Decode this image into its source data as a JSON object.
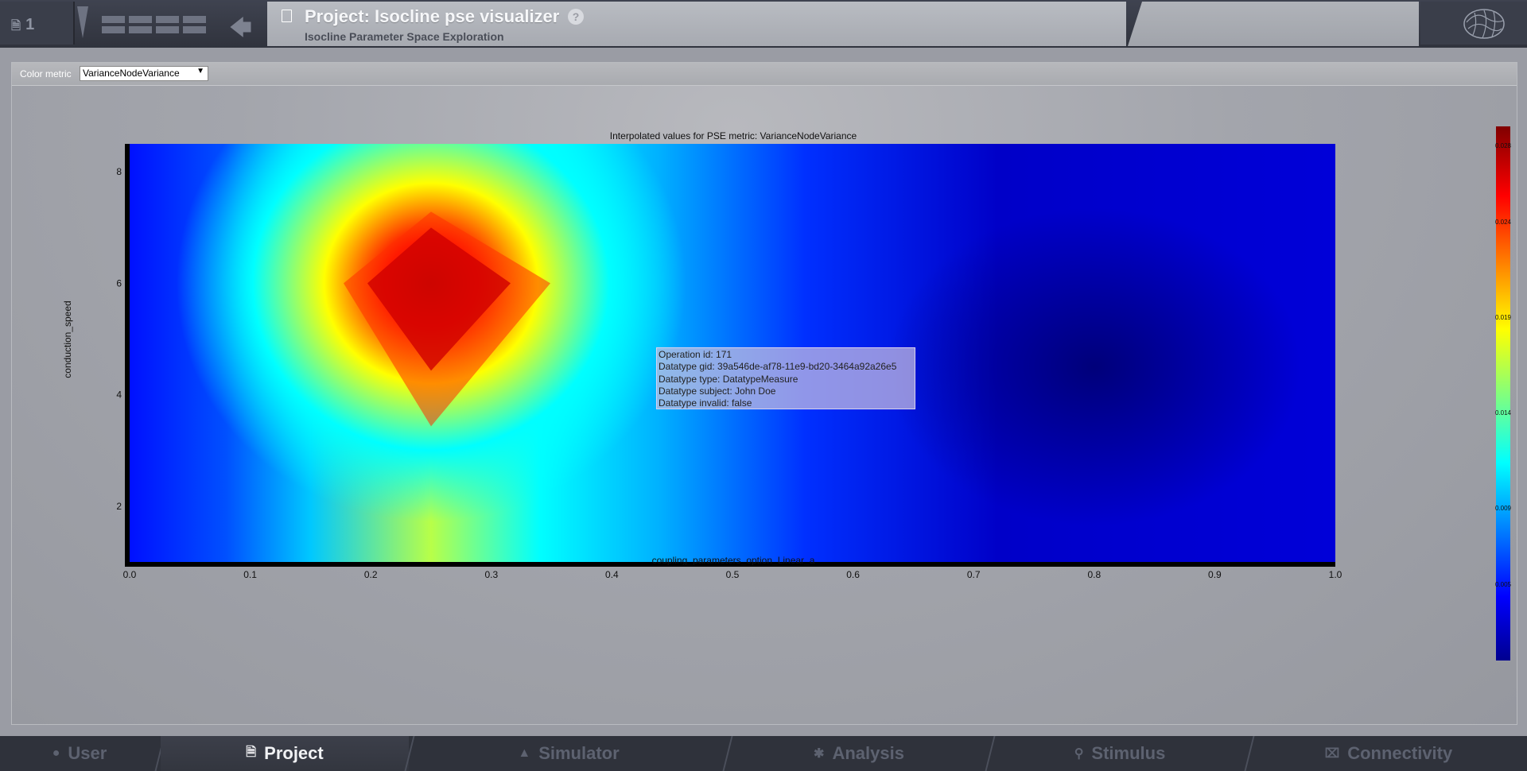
{
  "header": {
    "counter": "1",
    "title": "Project: Isocline pse visualizer",
    "subtitle": "Isocline Parameter Space Exploration",
    "help_glyph": "?",
    "icons": [
      "document-icon",
      "toggle-icon",
      "menu-grid-icon",
      "back-arrow-icon",
      "help-icon",
      "brain-logo-icon"
    ]
  },
  "toolbar": {
    "color_metric_label": "Color metric",
    "color_metric_value": "VarianceNodeVariance"
  },
  "colors": {
    "colormap": [
      "#00008f",
      "#0000ff",
      "#00ffff",
      "#ffff00",
      "#ff0000",
      "#800000"
    ]
  },
  "chart_data": {
    "type": "heatmap",
    "title": "Interpolated values for PSE metric: VarianceNodeVariance",
    "xlabel": "coupling_parameters_option_Linear_a",
    "ylabel": "conduction_speed",
    "xlim": [
      0.0,
      1.0
    ],
    "ylim": [
      1.0,
      8.5
    ],
    "x_ticks": [
      "0.0",
      "0.1",
      "0.2",
      "0.3",
      "0.4",
      "0.5",
      "0.6",
      "0.7",
      "0.8",
      "0.9",
      "1.0"
    ],
    "y_ticks": [
      "2",
      "4",
      "6",
      "8"
    ],
    "colorbar": {
      "ticks": [
        "0.005",
        "0.009",
        "0.014",
        "0.019",
        "0.024",
        "0.028"
      ],
      "range": [
        0.001,
        0.029
      ]
    },
    "peak": {
      "x": 0.25,
      "y": 6,
      "value": 0.029
    }
  },
  "tooltip": {
    "lines": [
      "Operation id: 171",
      "Datatype gid: 39a546de-af78-11e9-bd20-3464a92a26e5",
      "Datatype type: DatatypeMeasure",
      "Datatype subject: John Doe",
      "Datatype invalid: false"
    ]
  },
  "bottom_nav": {
    "tabs": [
      {
        "label": "User",
        "icon": "user-icon",
        "active": false
      },
      {
        "label": "Project",
        "icon": "document-icon",
        "active": true
      },
      {
        "label": "Simulator",
        "icon": "rocket-icon",
        "active": false
      },
      {
        "label": "Analysis",
        "icon": "gear-icon",
        "active": false
      },
      {
        "label": "Stimulus",
        "icon": "pin-icon",
        "active": false
      },
      {
        "label": "Connectivity",
        "icon": "network-icon",
        "active": false
      }
    ]
  }
}
